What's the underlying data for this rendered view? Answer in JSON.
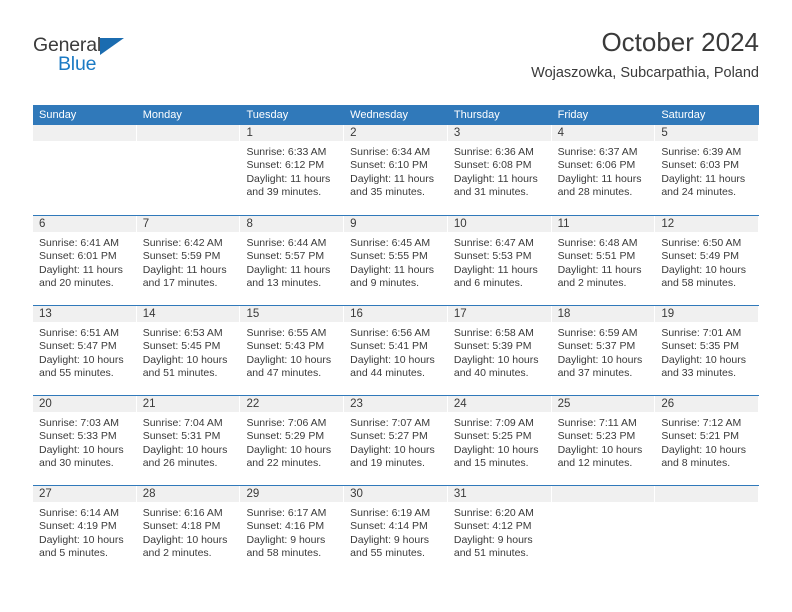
{
  "brand": {
    "name_top": "General",
    "name_bottom": "Blue",
    "accent_color": "#1b7ac4",
    "triangle_color": "#1b6cb0",
    "triangle_icon": "triangle-right-icon"
  },
  "header": {
    "title": "October 2024",
    "subtitle": "Wojaszowka, Subcarpathia, Poland"
  },
  "theme": {
    "header_blue": "#3079ba",
    "daynum_strip": "#f0f0f0",
    "text": "#3a3a3a"
  },
  "weekday_headers": [
    "Sunday",
    "Monday",
    "Tuesday",
    "Wednesday",
    "Thursday",
    "Friday",
    "Saturday"
  ],
  "weeks": [
    [
      {
        "day": "",
        "sunrise": "",
        "sunset": "",
        "daylight_1": "",
        "daylight_2": ""
      },
      {
        "day": "",
        "sunrise": "",
        "sunset": "",
        "daylight_1": "",
        "daylight_2": ""
      },
      {
        "day": "1",
        "sunrise": "Sunrise: 6:33 AM",
        "sunset": "Sunset: 6:12 PM",
        "daylight_1": "Daylight: 11 hours",
        "daylight_2": "and 39 minutes."
      },
      {
        "day": "2",
        "sunrise": "Sunrise: 6:34 AM",
        "sunset": "Sunset: 6:10 PM",
        "daylight_1": "Daylight: 11 hours",
        "daylight_2": "and 35 minutes."
      },
      {
        "day": "3",
        "sunrise": "Sunrise: 6:36 AM",
        "sunset": "Sunset: 6:08 PM",
        "daylight_1": "Daylight: 11 hours",
        "daylight_2": "and 31 minutes."
      },
      {
        "day": "4",
        "sunrise": "Sunrise: 6:37 AM",
        "sunset": "Sunset: 6:06 PM",
        "daylight_1": "Daylight: 11 hours",
        "daylight_2": "and 28 minutes."
      },
      {
        "day": "5",
        "sunrise": "Sunrise: 6:39 AM",
        "sunset": "Sunset: 6:03 PM",
        "daylight_1": "Daylight: 11 hours",
        "daylight_2": "and 24 minutes."
      }
    ],
    [
      {
        "day": "6",
        "sunrise": "Sunrise: 6:41 AM",
        "sunset": "Sunset: 6:01 PM",
        "daylight_1": "Daylight: 11 hours",
        "daylight_2": "and 20 minutes."
      },
      {
        "day": "7",
        "sunrise": "Sunrise: 6:42 AM",
        "sunset": "Sunset: 5:59 PM",
        "daylight_1": "Daylight: 11 hours",
        "daylight_2": "and 17 minutes."
      },
      {
        "day": "8",
        "sunrise": "Sunrise: 6:44 AM",
        "sunset": "Sunset: 5:57 PM",
        "daylight_1": "Daylight: 11 hours",
        "daylight_2": "and 13 minutes."
      },
      {
        "day": "9",
        "sunrise": "Sunrise: 6:45 AM",
        "sunset": "Sunset: 5:55 PM",
        "daylight_1": "Daylight: 11 hours",
        "daylight_2": "and 9 minutes."
      },
      {
        "day": "10",
        "sunrise": "Sunrise: 6:47 AM",
        "sunset": "Sunset: 5:53 PM",
        "daylight_1": "Daylight: 11 hours",
        "daylight_2": "and 6 minutes."
      },
      {
        "day": "11",
        "sunrise": "Sunrise: 6:48 AM",
        "sunset": "Sunset: 5:51 PM",
        "daylight_1": "Daylight: 11 hours",
        "daylight_2": "and 2 minutes."
      },
      {
        "day": "12",
        "sunrise": "Sunrise: 6:50 AM",
        "sunset": "Sunset: 5:49 PM",
        "daylight_1": "Daylight: 10 hours",
        "daylight_2": "and 58 minutes."
      }
    ],
    [
      {
        "day": "13",
        "sunrise": "Sunrise: 6:51 AM",
        "sunset": "Sunset: 5:47 PM",
        "daylight_1": "Daylight: 10 hours",
        "daylight_2": "and 55 minutes."
      },
      {
        "day": "14",
        "sunrise": "Sunrise: 6:53 AM",
        "sunset": "Sunset: 5:45 PM",
        "daylight_1": "Daylight: 10 hours",
        "daylight_2": "and 51 minutes."
      },
      {
        "day": "15",
        "sunrise": "Sunrise: 6:55 AM",
        "sunset": "Sunset: 5:43 PM",
        "daylight_1": "Daylight: 10 hours",
        "daylight_2": "and 47 minutes."
      },
      {
        "day": "16",
        "sunrise": "Sunrise: 6:56 AM",
        "sunset": "Sunset: 5:41 PM",
        "daylight_1": "Daylight: 10 hours",
        "daylight_2": "and 44 minutes."
      },
      {
        "day": "17",
        "sunrise": "Sunrise: 6:58 AM",
        "sunset": "Sunset: 5:39 PM",
        "daylight_1": "Daylight: 10 hours",
        "daylight_2": "and 40 minutes."
      },
      {
        "day": "18",
        "sunrise": "Sunrise: 6:59 AM",
        "sunset": "Sunset: 5:37 PM",
        "daylight_1": "Daylight: 10 hours",
        "daylight_2": "and 37 minutes."
      },
      {
        "day": "19",
        "sunrise": "Sunrise: 7:01 AM",
        "sunset": "Sunset: 5:35 PM",
        "daylight_1": "Daylight: 10 hours",
        "daylight_2": "and 33 minutes."
      }
    ],
    [
      {
        "day": "20",
        "sunrise": "Sunrise: 7:03 AM",
        "sunset": "Sunset: 5:33 PM",
        "daylight_1": "Daylight: 10 hours",
        "daylight_2": "and 30 minutes."
      },
      {
        "day": "21",
        "sunrise": "Sunrise: 7:04 AM",
        "sunset": "Sunset: 5:31 PM",
        "daylight_1": "Daylight: 10 hours",
        "daylight_2": "and 26 minutes."
      },
      {
        "day": "22",
        "sunrise": "Sunrise: 7:06 AM",
        "sunset": "Sunset: 5:29 PM",
        "daylight_1": "Daylight: 10 hours",
        "daylight_2": "and 22 minutes."
      },
      {
        "day": "23",
        "sunrise": "Sunrise: 7:07 AM",
        "sunset": "Sunset: 5:27 PM",
        "daylight_1": "Daylight: 10 hours",
        "daylight_2": "and 19 minutes."
      },
      {
        "day": "24",
        "sunrise": "Sunrise: 7:09 AM",
        "sunset": "Sunset: 5:25 PM",
        "daylight_1": "Daylight: 10 hours",
        "daylight_2": "and 15 minutes."
      },
      {
        "day": "25",
        "sunrise": "Sunrise: 7:11 AM",
        "sunset": "Sunset: 5:23 PM",
        "daylight_1": "Daylight: 10 hours",
        "daylight_2": "and 12 minutes."
      },
      {
        "day": "26",
        "sunrise": "Sunrise: 7:12 AM",
        "sunset": "Sunset: 5:21 PM",
        "daylight_1": "Daylight: 10 hours",
        "daylight_2": "and 8 minutes."
      }
    ],
    [
      {
        "day": "27",
        "sunrise": "Sunrise: 6:14 AM",
        "sunset": "Sunset: 4:19 PM",
        "daylight_1": "Daylight: 10 hours",
        "daylight_2": "and 5 minutes."
      },
      {
        "day": "28",
        "sunrise": "Sunrise: 6:16 AM",
        "sunset": "Sunset: 4:18 PM",
        "daylight_1": "Daylight: 10 hours",
        "daylight_2": "and 2 minutes."
      },
      {
        "day": "29",
        "sunrise": "Sunrise: 6:17 AM",
        "sunset": "Sunset: 4:16 PM",
        "daylight_1": "Daylight: 9 hours",
        "daylight_2": "and 58 minutes."
      },
      {
        "day": "30",
        "sunrise": "Sunrise: 6:19 AM",
        "sunset": "Sunset: 4:14 PM",
        "daylight_1": "Daylight: 9 hours",
        "daylight_2": "and 55 minutes."
      },
      {
        "day": "31",
        "sunrise": "Sunrise: 6:20 AM",
        "sunset": "Sunset: 4:12 PM",
        "daylight_1": "Daylight: 9 hours",
        "daylight_2": "and 51 minutes."
      },
      {
        "day": "",
        "sunrise": "",
        "sunset": "",
        "daylight_1": "",
        "daylight_2": ""
      },
      {
        "day": "",
        "sunrise": "",
        "sunset": "",
        "daylight_1": "",
        "daylight_2": ""
      }
    ]
  ]
}
